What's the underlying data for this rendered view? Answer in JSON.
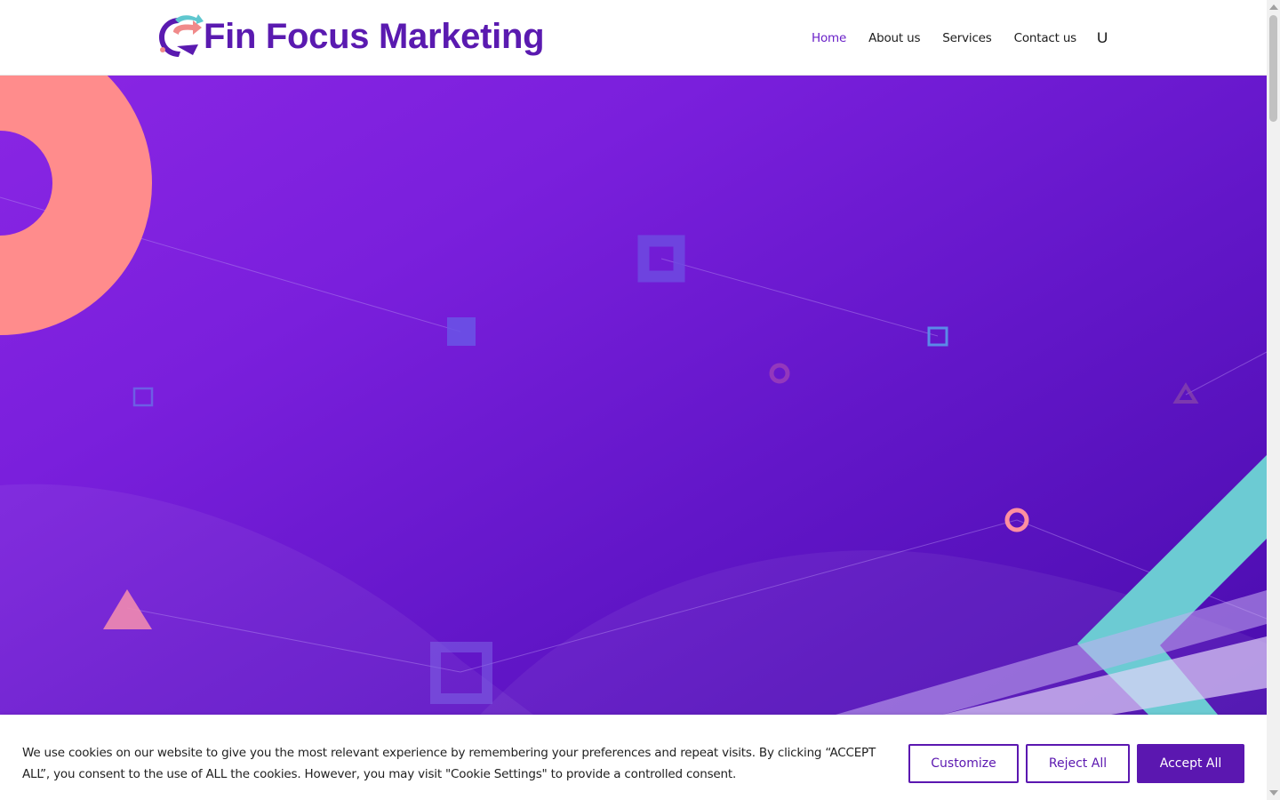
{
  "header": {
    "brand_name": "Fin Focus Marketing",
    "nav": [
      {
        "label": "Home",
        "active": true
      },
      {
        "label": "About us",
        "active": false
      },
      {
        "label": "Services",
        "active": false
      },
      {
        "label": "Contact us",
        "active": false
      }
    ],
    "user_icon": "U"
  },
  "colors": {
    "brand": "#5a1ab0",
    "hero_gradient": [
      "#8a26e4",
      "#4a0cae"
    ],
    "accent_coral": "#ff8c8c",
    "accent_teal": "#6ccbd3",
    "button": "#5b17b0"
  },
  "cookie_banner": {
    "message": "We use cookies on our website to give you the most relevant experience by remembering your preferences and repeat visits. By clicking “ACCEPT ALL”, you consent to the use of ALL the cookies. However, you may visit \"Cookie Settings\" to provide a controlled consent.",
    "customize_label": "Customize",
    "reject_label": "Reject All",
    "accept_label": "Accept All"
  }
}
